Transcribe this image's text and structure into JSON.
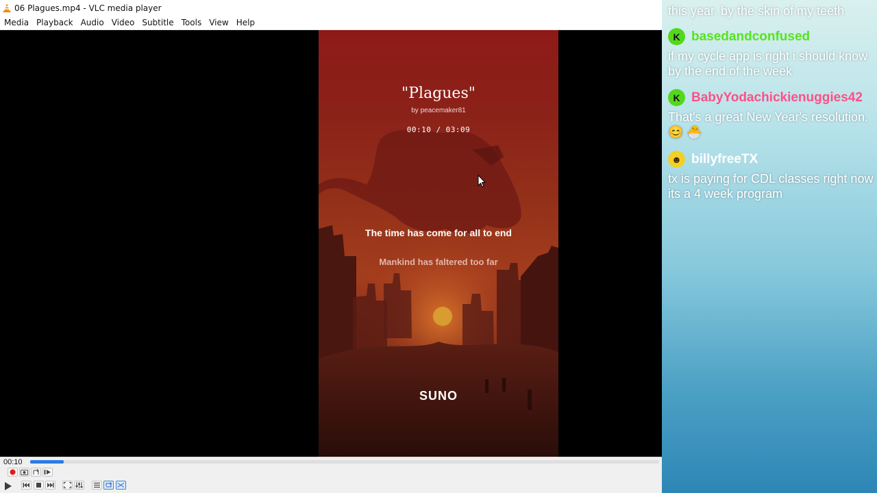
{
  "window": {
    "title": "06 Plagues.mp4 - VLC media player"
  },
  "menu": [
    "Media",
    "Playback",
    "Audio",
    "Video",
    "Subtitle",
    "Tools",
    "View",
    "Help"
  ],
  "video": {
    "song_title": "\"Plagues\"",
    "song_author": "by peacemaker81",
    "song_time": "00:10 / 03:09",
    "lyric_current": "The time has come for all to end",
    "lyric_next": "Mankind has faltered too far",
    "brand": "SUNO"
  },
  "player": {
    "elapsed": "00:10",
    "progress_fraction": 0.053,
    "loop_active": true,
    "shuffle_active": true
  },
  "chat": {
    "messages": [
      {
        "user": "",
        "text": "this year. by the skin of my teeth"
      },
      {
        "user": "basedandconfused",
        "badge": "K",
        "color": "#55e41e",
        "text": "if my cycle app is right i should know by the end of the week"
      },
      {
        "user": "BabyYodachickienuggies42",
        "badge": "K",
        "color": "#ff4f86",
        "text": "That's a great New Year's resolution. 😊 🐣"
      },
      {
        "user": "billyfreeTX",
        "badge": "☻",
        "color": "#ffffff",
        "text": "tx is paying for CDL classes right now its a 4 week program"
      }
    ]
  },
  "colors": {
    "accent": "#2b7de0",
    "record": "#e01b1b"
  }
}
